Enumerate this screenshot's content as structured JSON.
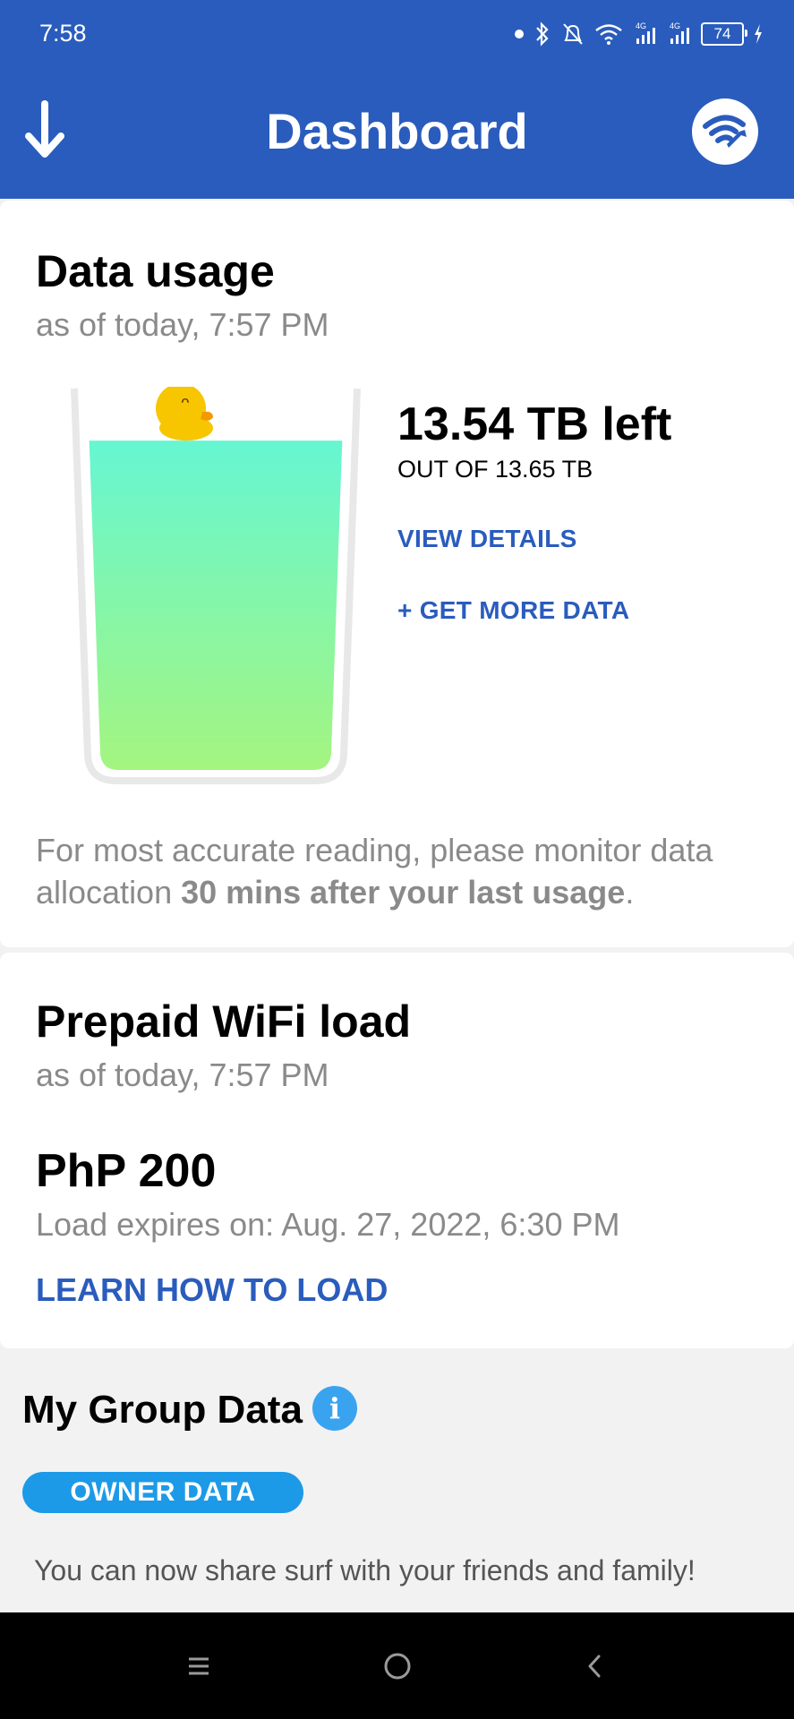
{
  "status_bar": {
    "time": "7:58",
    "battery": "74",
    "icons": [
      "notification-dot",
      "bluetooth-icon",
      "mute-icon",
      "wifi-icon",
      "signal-4g-icon",
      "signal-4g-icon",
      "battery-icon",
      "charging-icon"
    ]
  },
  "app_bar": {
    "title": "Dashboard",
    "left_icon": "down-arrow-icon",
    "right_icon": "wifi-wrench-icon",
    "color": "#2a5cbd"
  },
  "data_usage": {
    "title": "Data usage",
    "as_of": "as of today, 7:57 PM",
    "left_amount": "13.54 TB left",
    "out_of": "OUT OF 13.65 TB",
    "view_details": "VIEW DETAILS",
    "get_more": "+ GET MORE DATA",
    "note_prefix": "For most accurate reading, please monitor data allocation ",
    "note_bold": "30 mins after your last usage",
    "note_suffix": ".",
    "fill_fraction": 0.99
  },
  "prepaid": {
    "title": "Prepaid WiFi load",
    "as_of": "as of today, 7:57 PM",
    "amount": "PhP 200",
    "expires": "Load expires on: Aug. 27, 2022, 6:30 PM",
    "learn_link": "LEARN HOW TO LOAD"
  },
  "group_data": {
    "title": "My Group Data",
    "info_icon": "i",
    "owner_pill": "OWNER DATA",
    "share_text": "You can now share surf with your friends and family!"
  },
  "nav_bar": {
    "buttons": [
      "recents-icon",
      "home-icon",
      "back-icon"
    ]
  }
}
